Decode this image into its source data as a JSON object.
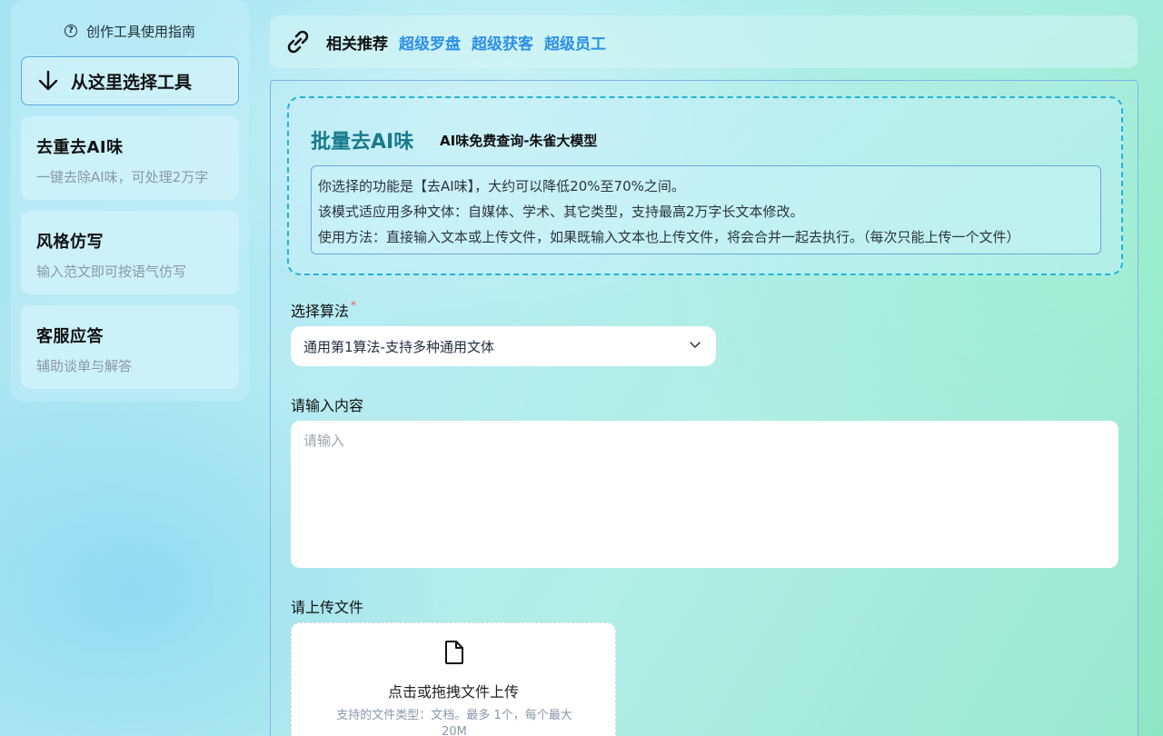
{
  "sidebar": {
    "guide_label": "创作工具使用指南",
    "select_tool_label": "从这里选择工具",
    "tools": [
      {
        "title": "去重去AI味",
        "subtitle": "一键去除AI味，可处理2万字"
      },
      {
        "title": "风格仿写",
        "subtitle": "输入范文即可按语气仿写"
      },
      {
        "title": "客服应答",
        "subtitle": "辅助谈单与解答"
      }
    ]
  },
  "topbar": {
    "related_label": "相关推荐",
    "links": [
      "超级罗盘",
      "超级获客",
      "超级员工"
    ],
    "icon": "link-icon"
  },
  "intro": {
    "title": "批量去AI味",
    "subtitle": "AI味免费查询-朱雀大模型",
    "lines": [
      "你选择的功能是【去AI味】，大约可以降低20%至70%之间。",
      "该模式适应用多种文体：自媒体、学术、其它类型，支持最高2万字长文本修改。",
      "使用方法：直接输入文本或上传文件，如果既输入文本也上传文件，将会合并一起去执行。（每次只能上传一个文件）"
    ]
  },
  "form": {
    "algorithm_label": "选择算法",
    "required_mark": "*",
    "algorithm_value": "通用第1算法-支持多种通用文体",
    "content_label": "请输入内容",
    "content_placeholder": "请输入",
    "upload_label": "请上传文件",
    "upload_title": "点击或拖拽文件上传",
    "upload_hint": "支持的文件类型：文档。最多 1个，每个最大 20M"
  },
  "colors": {
    "accent_link": "#2d8fe6",
    "intro_title": "#1a7a8e",
    "dashed_border": "#22b3d8",
    "required": "#f25b5b"
  }
}
